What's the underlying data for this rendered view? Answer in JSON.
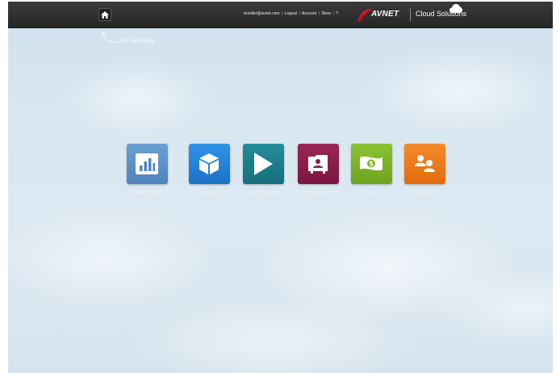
{
  "topbar": {
    "user_email": "reseller@avnet.com",
    "logout_label": "Logout",
    "account_label": "Account",
    "store_label": "Store",
    "help_label": "?",
    "separator": "|",
    "logo_text": "AVNET",
    "product_name": "Cloud Solutions",
    "home_icon": "home-icon",
    "cloud_icon": "cloud-icon"
  },
  "hint": {
    "text": "You are here"
  },
  "tiles": [
    {
      "label": "Dashboard",
      "icon": "bar-chart-icon",
      "color": "#5b8fc4"
    },
    {
      "label": "Products",
      "icon": "cube-icon",
      "color": "#1f7fd4"
    },
    {
      "label": "Test Drives",
      "icon": "play-icon",
      "color": "#1a7d8a"
    },
    {
      "label": "Customers",
      "icon": "contact-card-icon",
      "color": "#8a1e4a"
    },
    {
      "label": "Billing",
      "icon": "money-icon",
      "color": "#7fb526"
    },
    {
      "label": "Partners",
      "icon": "people-icon",
      "color": "#f07a18"
    }
  ],
  "colors": {
    "topbar_bg": "#2e2e2e",
    "brand_red": "#e0192c"
  }
}
